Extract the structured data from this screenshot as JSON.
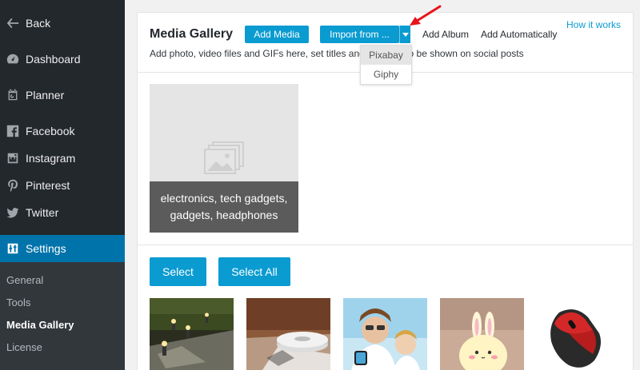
{
  "sidebar": {
    "back": "Back",
    "items": [
      {
        "label": "Dashboard",
        "icon": "dashboard-icon"
      },
      {
        "label": "Planner",
        "icon": "calendar-icon"
      },
      {
        "label": "Facebook",
        "icon": "facebook-icon"
      },
      {
        "label": "Instagram",
        "icon": "instagram-icon"
      },
      {
        "label": "Pinterest",
        "icon": "pinterest-icon"
      },
      {
        "label": "Twitter",
        "icon": "twitter-icon"
      }
    ],
    "settings": "Settings",
    "submenu": [
      "General",
      "Tools",
      "Media Gallery",
      "License"
    ]
  },
  "header": {
    "title": "Media Gallery",
    "add_media": "Add Media",
    "import_from": "Import from ...",
    "add_album": "Add Album",
    "add_automatically": "Add Automatically",
    "how_it_works": "How it works",
    "subtitle": "Add photo, video files and GIFs here, set titles and captions to be shown on social posts"
  },
  "import_dropdown": {
    "options": [
      "Pixabay",
      "Giphy"
    ],
    "highlighted": "Pixabay"
  },
  "album": {
    "caption_line1": "electronics, tech gadgets,",
    "caption_line2": "gadgets, headphones"
  },
  "actions": {
    "select": "Select",
    "select_all": "Select All"
  },
  "thumbnails": [
    {
      "subject": "garden lamps"
    },
    {
      "subject": "robot vacuum"
    },
    {
      "subject": "mother and child with smartwatch"
    },
    {
      "subject": "bunny night lamp"
    },
    {
      "subject": "red wireless mouse"
    }
  ],
  "colors": {
    "sidebar_bg": "#23282d",
    "active_bg": "#0073aa",
    "button_blue": "#0a9bd1",
    "annotation_red": "#e8141b"
  }
}
